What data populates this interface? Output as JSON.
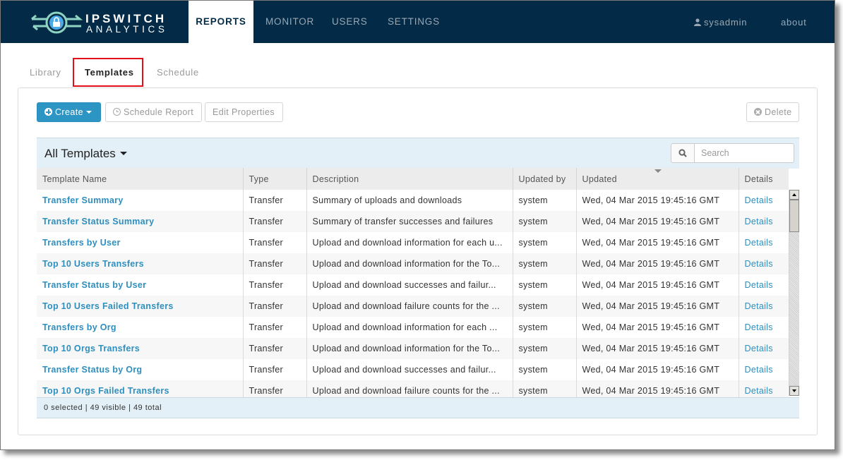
{
  "brand": {
    "line1": "IPSWITCH",
    "line2": "ANALYTICS"
  },
  "nav": {
    "items": [
      {
        "label": "REPORTS",
        "active": true
      },
      {
        "label": "MONITOR",
        "active": false
      },
      {
        "label": "USERS",
        "active": false
      },
      {
        "label": "SETTINGS",
        "active": false
      }
    ],
    "user": "sysadmin",
    "about": "about"
  },
  "subtabs": [
    {
      "label": "Library",
      "active": false
    },
    {
      "label": "Templates",
      "active": true
    },
    {
      "label": "Schedule",
      "active": false
    }
  ],
  "toolbar": {
    "create": "Create",
    "schedule_report": "Schedule Report",
    "edit_properties": "Edit Properties",
    "delete": "Delete"
  },
  "grid": {
    "title": "All Templates",
    "search_placeholder": "Search",
    "search_value": "",
    "columns": [
      "Template Name",
      "Type",
      "Description",
      "Updated by",
      "Updated",
      "Details"
    ],
    "sorted_column": "Updated",
    "sort_direction": "descending",
    "rows": [
      {
        "name": "Transfer Summary",
        "type": "Transfer",
        "description": "Summary of uploads and downloads",
        "updated_by": "system",
        "updated": "Wed, 04 Mar 2015 19:45:16 GMT",
        "details": "Details"
      },
      {
        "name": "Transfer Status Summary",
        "type": "Transfer",
        "description": "Summary of transfer successes and failures",
        "updated_by": "system",
        "updated": "Wed, 04 Mar 2015 19:45:16 GMT",
        "details": "Details"
      },
      {
        "name": "Transfers by User",
        "type": "Transfer",
        "description": "Upload and download information for each u...",
        "updated_by": "system",
        "updated": "Wed, 04 Mar 2015 19:45:16 GMT",
        "details": "Details"
      },
      {
        "name": "Top 10 Users Transfers",
        "type": "Transfer",
        "description": "Upload and download information for the To...",
        "updated_by": "system",
        "updated": "Wed, 04 Mar 2015 19:45:16 GMT",
        "details": "Details"
      },
      {
        "name": "Transfer Status by User",
        "type": "Transfer",
        "description": "Upload and download successes and failur...",
        "updated_by": "system",
        "updated": "Wed, 04 Mar 2015 19:45:16 GMT",
        "details": "Details"
      },
      {
        "name": "Top 10 Users Failed Transfers",
        "type": "Transfer",
        "description": "Upload and download failure counts for the ...",
        "updated_by": "system",
        "updated": "Wed, 04 Mar 2015 19:45:16 GMT",
        "details": "Details"
      },
      {
        "name": "Transfers by Org",
        "type": "Transfer",
        "description": "Upload and download information for each ...",
        "updated_by": "system",
        "updated": "Wed, 04 Mar 2015 19:45:16 GMT",
        "details": "Details"
      },
      {
        "name": "Top 10 Orgs Transfers",
        "type": "Transfer",
        "description": "Upload and download information for the To...",
        "updated_by": "system",
        "updated": "Wed, 04 Mar 2015 19:45:16 GMT",
        "details": "Details"
      },
      {
        "name": "Transfer Status by Org",
        "type": "Transfer",
        "description": "Upload and download successes and failur...",
        "updated_by": "system",
        "updated": "Wed, 04 Mar 2015 19:45:16 GMT",
        "details": "Details"
      },
      {
        "name": "Top 10 Orgs Failed Transfers",
        "type": "Transfer",
        "description": "Upload and download failure counts for the ...",
        "updated_by": "system",
        "updated": "Wed, 04 Mar 2015 19:45:16 GMT",
        "details": "Details"
      }
    ],
    "footer": "0 selected | 49 visible | 49 total"
  },
  "colors": {
    "navbar": "#032b47",
    "accent": "#2d95c4",
    "link": "#2d8fbf",
    "highlight_box": "#e3101a",
    "grid_header_bg": "#e3f0f7"
  }
}
